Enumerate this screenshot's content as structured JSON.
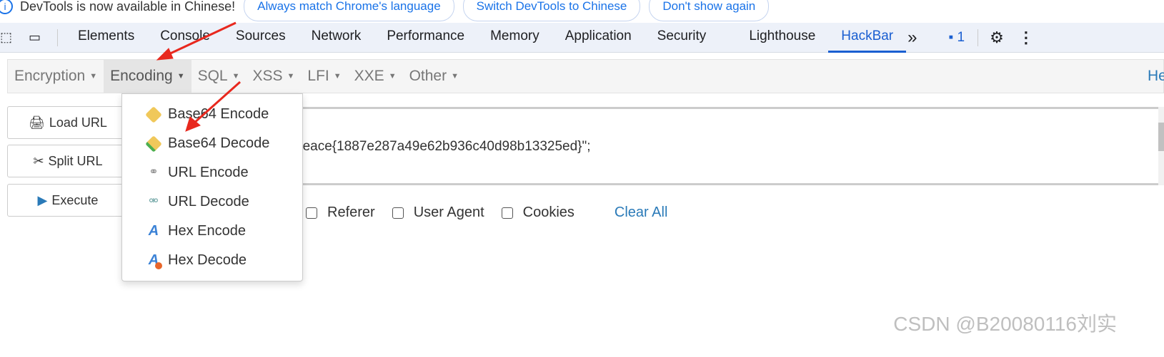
{
  "infobar": {
    "message": "DevTools is now available in Chinese!",
    "buttons": [
      "Always match Chrome's language",
      "Switch DevTools to Chinese",
      "Don't show again"
    ]
  },
  "tabs": [
    "Elements",
    "Console",
    "Sources",
    "Network",
    "Performance",
    "Memory",
    "Application",
    "Security",
    "Lighthouse",
    "HackBar"
  ],
  "active_tab": "HackBar",
  "more": "»",
  "issues_count": "1",
  "hackbar": {
    "menus": [
      "Encryption",
      "Encoding",
      "SQL",
      "XSS",
      "LFI",
      "XXE",
      "Other"
    ],
    "help": "Help",
    "buttons": [
      "Load URL",
      "Split URL",
      "Execute"
    ],
    "textarea": "peace{1887e287a49e62b936c40d98b13325ed}\";",
    "checkboxes": [
      "Referer",
      "User Agent",
      "Cookies"
    ],
    "clear_all": "Clear All",
    "dropdown": [
      "Base64 Encode",
      "Base64 Decode",
      "URL Encode",
      "URL Decode",
      "Hex Encode",
      "Hex Decode"
    ]
  },
  "watermark": "CSDN @B20080116刘实",
  "colors": {
    "accent": "#1a5fd1",
    "arrow": "#e8281e"
  }
}
